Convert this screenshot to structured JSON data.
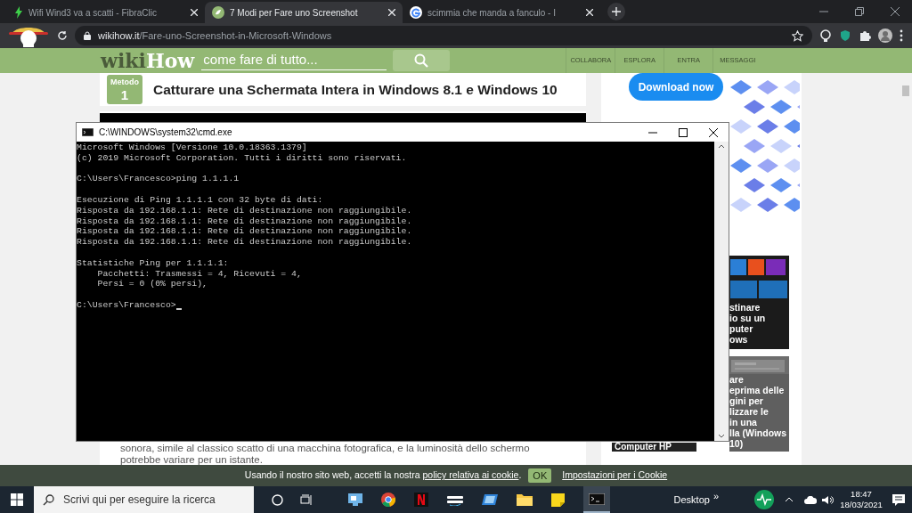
{
  "browser": {
    "tabs": [
      {
        "title": "Wifi Wind3 va a scatti - FibraClic",
        "selected": false
      },
      {
        "title": "7 Modi per Fare uno Screenshot",
        "selected": true
      },
      {
        "title": "scimmia che manda a fanculo - I",
        "selected": false
      }
    ],
    "url_domain": "wikihow.it",
    "url_path": "/Fare-uno-Screenshot-in-Microsoft-Windows"
  },
  "site": {
    "logo_a": "wiki",
    "logo_b": "How",
    "search": {
      "placeholder": "come fare di tutto..."
    },
    "nav": [
      "COLLABORA",
      "ESPLORA",
      "ENTRA",
      "MESSAGGI"
    ]
  },
  "article": {
    "method_label": "Metodo",
    "method_number": "1",
    "heading": "Catturare una Schermata Intera in Windows 8.1 e Windows 10",
    "paragraph_lines": [
      "sonora, simile al classico scatto di una macchina fotografica, e la luminosità dello schermo",
      "potrebbe variare per un istante."
    ]
  },
  "sidebar": {
    "download_button": "Download now",
    "cards": [
      {
        "lines": [
          "stinare",
          "io su un",
          "puter",
          "ows"
        ]
      },
      {
        "lines": [
          "are",
          "eprima delle",
          "gini per",
          "lizzare le",
          "in una",
          "lla (Windows",
          "10)"
        ]
      }
    ],
    "caption": "Computer HP"
  },
  "cmd": {
    "title": "C:\\WINDOWS\\system32\\cmd.exe",
    "blocks": [
      [
        "Microsoft Windows [Versione 10.0.18363.1379]",
        "(c) 2019 Microsoft Corporation. Tutti i diritti sono riservati."
      ],
      [
        "C:\\Users\\Francesco>ping 1.1.1.1"
      ],
      [
        "Esecuzione di Ping 1.1.1.1 con 32 byte di dati:",
        "Risposta da 192.168.1.1: Rete di destinazione non raggiungibile.",
        "Risposta da 192.168.1.1: Rete di destinazione non raggiungibile.",
        "Risposta da 192.168.1.1: Rete di destinazione non raggiungibile.",
        "Risposta da 192.168.1.1: Rete di destinazione non raggiungibile."
      ],
      [
        "Statistiche Ping per 1.1.1.1:",
        "    Pacchetti: Trasmessi = 4, Ricevuti = 4,",
        "    Persi = 0 (0% persi),"
      ]
    ],
    "prompt": "C:\\Users\\Francesco>"
  },
  "cookie_bar": {
    "text": "Usando il nostro sito web, accetti la nostra ",
    "link": "policy relativa ai cookie",
    "after": ".",
    "ok": "OK",
    "settings": "Impostazioni per i Cookie"
  },
  "taskbar": {
    "search_placeholder": "Scrivi qui per eseguire la ricerca",
    "desktop": "Desktop",
    "more": "»",
    "time": "18:47",
    "date": "18/03/2021"
  }
}
